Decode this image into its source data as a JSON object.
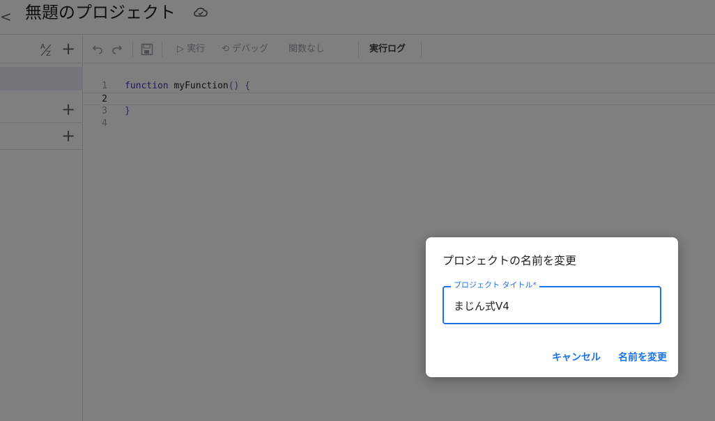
{
  "header": {
    "back_glyph": "<",
    "project_title": "無題のプロジェクト"
  },
  "toolbar": {
    "run_label": "実行",
    "debug_label": "デバッグ",
    "function_select": "関数なし",
    "log_label": "実行ログ"
  },
  "editor": {
    "lines": [
      {
        "number": "1",
        "keyword": "function",
        "name": " myFunction",
        "punct": "() {"
      },
      {
        "number": "2",
        "text": ""
      },
      {
        "number": "3",
        "punct": "}"
      },
      {
        "number": "4",
        "text": ""
      }
    ]
  },
  "dialog": {
    "title": "プロジェクトの名前を変更",
    "field_label": "プロジェクト タイトル*",
    "field_value": "まじん式V4",
    "cancel_label": "キャンセル",
    "rename_label": "名前を変更"
  },
  "colors": {
    "accent": "#1a73e8",
    "overlay": "rgba(0,0,0,0.5)"
  }
}
